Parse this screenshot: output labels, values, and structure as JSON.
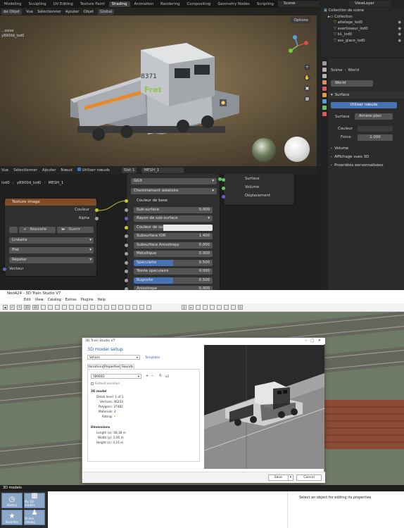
{
  "blender": {
    "workspace_tabs": [
      "Modeling",
      "Sculpting",
      "UV Editing",
      "Texture Paint",
      "Shading",
      "Animation",
      "Rendering",
      "Compositing",
      "Geometry Nodes",
      "Scripting"
    ],
    "active_tab": "Shading",
    "scene": "Scene",
    "view_layer": "ViewLayer",
    "viewport": {
      "mode": "de Objet",
      "menus": [
        "Vue",
        "Sélectionner",
        "Ajouter",
        "Objet"
      ],
      "transform": "Global",
      "options": "Options",
      "object_label_1": "...ssive",
      "object_label_2": "y8900d_lod0"
    },
    "outliner": {
      "title": "Collection de scène",
      "collection": "Collection",
      "items": [
        "attelage_lod0",
        "avertisseur_lod0",
        "b1_lod0",
        "ess_glace_lod0"
      ]
    },
    "properties": {
      "scene": "Scène",
      "world_tab": "World",
      "world_name": "World",
      "surface_panel": "Surface",
      "use_nodes": "Utiliser nœuds",
      "surface_label": "Surface",
      "surface_value": "Arrière-plan",
      "color_label": "Couleur",
      "strength_label": "Force",
      "strength_value": "1.000",
      "volume_panel": "Volume",
      "display_panel": "Affichage vues 3D",
      "custom_panel": "Propriétés personnalisées"
    },
    "node_editor": {
      "menus": [
        "Vue",
        "Sélectionner",
        "Ajouter",
        "Nœud"
      ],
      "use_nodes": "Utiliser nœuds",
      "slot": "Slot 1",
      "material": "MESH_1",
      "breadcrumb": [
        "lod0",
        "y8900d_lod0",
        "MESH_1"
      ],
      "texture_node": {
        "title": "Texture image",
        "out_color": "Couleur",
        "out_alpha": "Alpha",
        "new_btn": "Nouvelle",
        "open_btn": "Ouvrir",
        "interpolation": "Linéaire",
        "projection": "Plat",
        "extension": "Répéter",
        "vector": "Vecteur"
      },
      "bsdf_node": {
        "distribution": "GGX",
        "subsurface_method": "Cheminement aléatoire",
        "rows": [
          {
            "label": "Couleur de base",
            "value": "",
            "kind": "socket"
          },
          {
            "label": "Sub-surface",
            "value": "0.000",
            "kind": "field"
          },
          {
            "label": "Rayon de sub-surface",
            "value": "",
            "kind": "dropdown"
          },
          {
            "label": "Couleur de sub...",
            "value": "",
            "kind": "color"
          },
          {
            "label": "Subsurface IOR",
            "value": "1.400",
            "kind": "field"
          },
          {
            "label": "Subsurface Anisotropy",
            "value": "0.000",
            "kind": "field"
          },
          {
            "label": "Métallique",
            "value": "0.000",
            "kind": "field"
          },
          {
            "label": "Spéculaire",
            "value": "0.500",
            "kind": "bar",
            "fill": 0.5
          },
          {
            "label": "Teinte spéculaire",
            "value": "0.000",
            "kind": "field"
          },
          {
            "label": "Rugosité",
            "value": "0.500",
            "kind": "bar",
            "fill": 0.5
          },
          {
            "label": "Anisotrope",
            "value": "0.000",
            "kind": "field"
          }
        ]
      },
      "output_node": {
        "outputs": [
          "Surface",
          "Volume",
          "Déplacement"
        ]
      }
    }
  },
  "studio": {
    "window_title": "Nod424 - 3D Train Studio V7",
    "menus": [
      "Edit",
      "View",
      "Catalog",
      "Extras",
      "Plugins",
      "Help"
    ],
    "toolbar_labels": [
      "2D",
      "3D"
    ],
    "status_text": "3D models",
    "select_hint": "Select an object for editing its properties",
    "library": [
      "History",
      "My 3D models",
      "Favorites",
      "Online catalog"
    ],
    "dialog": {
      "title": "3D Train Studio V7",
      "heading": "3D model setup",
      "category": "Vehicle",
      "templates_link": "Templates",
      "tabs": [
        "Variations",
        "Properties",
        "Sounds"
      ],
      "variant_name": "Y8900D",
      "variant_count": "x2",
      "default_variation": "Default variation",
      "section_3d": "3D model",
      "info": [
        {
          "label": "Detail level:",
          "value": "1 of 1"
        },
        {
          "label": "Vertices:",
          "value": "46233"
        },
        {
          "label": "Polygons:",
          "value": "37482"
        },
        {
          "label": "Materials:",
          "value": "2"
        },
        {
          "label": "Rating:",
          "value": ""
        }
      ],
      "section_dims": "Dimensions",
      "dims": [
        {
          "label": "Length (x):",
          "value": "08,38 m"
        },
        {
          "label": "Width (y):",
          "value": "2,95 m"
        },
        {
          "label": "Height (z):",
          "value": "4,16 m"
        }
      ],
      "save": "Save",
      "cancel": "Cancel"
    }
  },
  "colors": {
    "blender_accent": "#4772b3",
    "node_texture_header": "#7e4a28",
    "node_socket_yellow": "#c7c729",
    "node_socket_grey": "#a1a1a1",
    "node_socket_green": "#63c763",
    "node_socket_purple": "#6363c7",
    "studio_link": "#1f5fa8"
  }
}
